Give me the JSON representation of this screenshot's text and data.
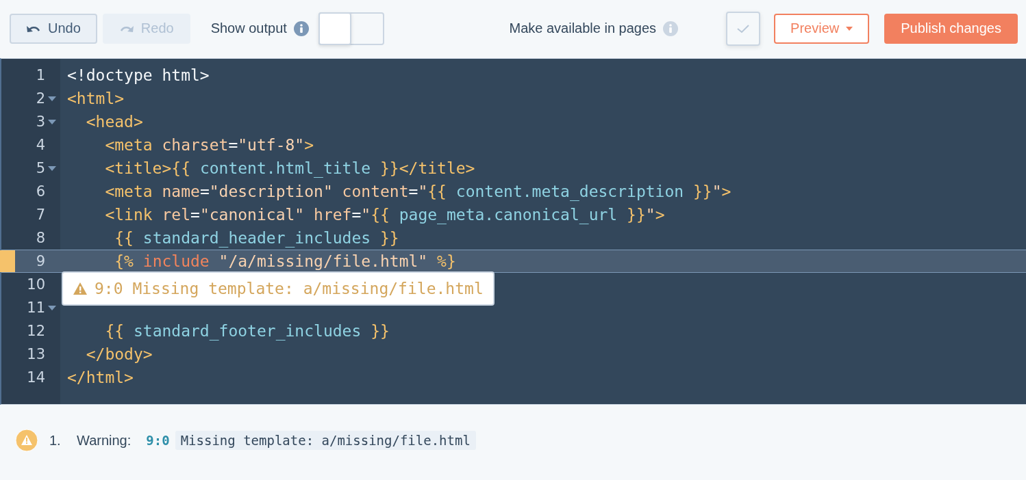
{
  "toolbar": {
    "undo": {
      "label": "Undo",
      "disabled": false
    },
    "redo": {
      "label": "Redo",
      "disabled": true
    },
    "show_output": {
      "label": "Show output",
      "on": false
    },
    "make_available": {
      "label": "Make available in pages"
    },
    "preview": {
      "label": "Preview"
    },
    "publish": {
      "label": "Publish changes"
    }
  },
  "editor": {
    "lines": [
      {
        "number": "1",
        "fold": false,
        "highlighted": false,
        "tokens": [
          {
            "kind": "plain",
            "text": "<!doctype html>"
          }
        ]
      },
      {
        "number": "2",
        "fold": true,
        "highlighted": false,
        "tokens": [
          {
            "kind": "tag",
            "text": "<html>"
          }
        ]
      },
      {
        "number": "3",
        "fold": true,
        "highlighted": false,
        "tokens": [
          {
            "kind": "tag",
            "text": "  <head>"
          }
        ]
      },
      {
        "number": "4",
        "fold": false,
        "highlighted": false,
        "tokens": [
          {
            "kind": "tag",
            "text": "    <meta"
          },
          {
            "kind": "attr",
            "text": " charset"
          },
          {
            "kind": "plain",
            "text": "="
          },
          {
            "kind": "string",
            "text": "\"utf-8\""
          },
          {
            "kind": "tag",
            "text": ">"
          }
        ]
      },
      {
        "number": "5",
        "fold": true,
        "highlighted": false,
        "tokens": [
          {
            "kind": "tag",
            "text": "    <title>"
          },
          {
            "kind": "delim",
            "text": "{{"
          },
          {
            "kind": "var",
            "text": " content.html_title "
          },
          {
            "kind": "delim",
            "text": "}}"
          },
          {
            "kind": "tag",
            "text": "</title>"
          }
        ]
      },
      {
        "number": "6",
        "fold": false,
        "highlighted": false,
        "tokens": [
          {
            "kind": "tag",
            "text": "    <meta"
          },
          {
            "kind": "attr",
            "text": " name"
          },
          {
            "kind": "plain",
            "text": "="
          },
          {
            "kind": "string",
            "text": "\"description\""
          },
          {
            "kind": "attr",
            "text": " content"
          },
          {
            "kind": "plain",
            "text": "="
          },
          {
            "kind": "string",
            "text": "\""
          },
          {
            "kind": "delim",
            "text": "{{"
          },
          {
            "kind": "var",
            "text": " content.meta_description "
          },
          {
            "kind": "delim",
            "text": "}}"
          },
          {
            "kind": "string",
            "text": "\""
          },
          {
            "kind": "tag",
            "text": ">"
          }
        ]
      },
      {
        "number": "7",
        "fold": false,
        "highlighted": false,
        "tokens": [
          {
            "kind": "tag",
            "text": "    <link"
          },
          {
            "kind": "attr",
            "text": " rel"
          },
          {
            "kind": "plain",
            "text": "="
          },
          {
            "kind": "string",
            "text": "\"canonical\""
          },
          {
            "kind": "attr",
            "text": " href"
          },
          {
            "kind": "plain",
            "text": "="
          },
          {
            "kind": "string",
            "text": "\""
          },
          {
            "kind": "delim",
            "text": "{{"
          },
          {
            "kind": "var",
            "text": " page_meta.canonical_url "
          },
          {
            "kind": "delim",
            "text": "}}"
          },
          {
            "kind": "string",
            "text": "\""
          },
          {
            "kind": "tag",
            "text": ">"
          }
        ]
      },
      {
        "number": "8",
        "fold": false,
        "highlighted": false,
        "tokens": [
          {
            "kind": "delim",
            "text": "     {{"
          },
          {
            "kind": "var",
            "text": " standard_header_includes "
          },
          {
            "kind": "delim",
            "text": "}}"
          }
        ]
      },
      {
        "number": "9",
        "fold": false,
        "highlighted": true,
        "tokens": [
          {
            "kind": "delim",
            "text": "     {%"
          },
          {
            "kind": "keyword",
            "text": " include"
          },
          {
            "kind": "string",
            "text": " \"/a/missing/file.html\""
          },
          {
            "kind": "delim",
            "text": " %}"
          }
        ]
      },
      {
        "number": "10",
        "fold": false,
        "highlighted": false
      },
      {
        "number": "11",
        "fold": true,
        "highlighted": false
      },
      {
        "number": "12",
        "fold": false,
        "highlighted": false,
        "tokens": [
          {
            "kind": "delim",
            "text": "    {{"
          },
          {
            "kind": "var",
            "text": " standard_footer_includes "
          },
          {
            "kind": "delim",
            "text": "}}"
          }
        ]
      },
      {
        "number": "13",
        "fold": false,
        "highlighted": false,
        "tokens": [
          {
            "kind": "tag",
            "text": "  </body>"
          }
        ]
      },
      {
        "number": "14",
        "fold": false,
        "highlighted": false,
        "tokens": [
          {
            "kind": "tag",
            "text": "</html>"
          }
        ]
      }
    ],
    "tooltip": {
      "position": "9:0",
      "message": "Missing template: a/missing/file.html"
    }
  },
  "problems": [
    {
      "index": "1.",
      "severity": "Warning:",
      "position": "9:0",
      "message": "Missing template: a/missing/file.html"
    }
  ]
}
